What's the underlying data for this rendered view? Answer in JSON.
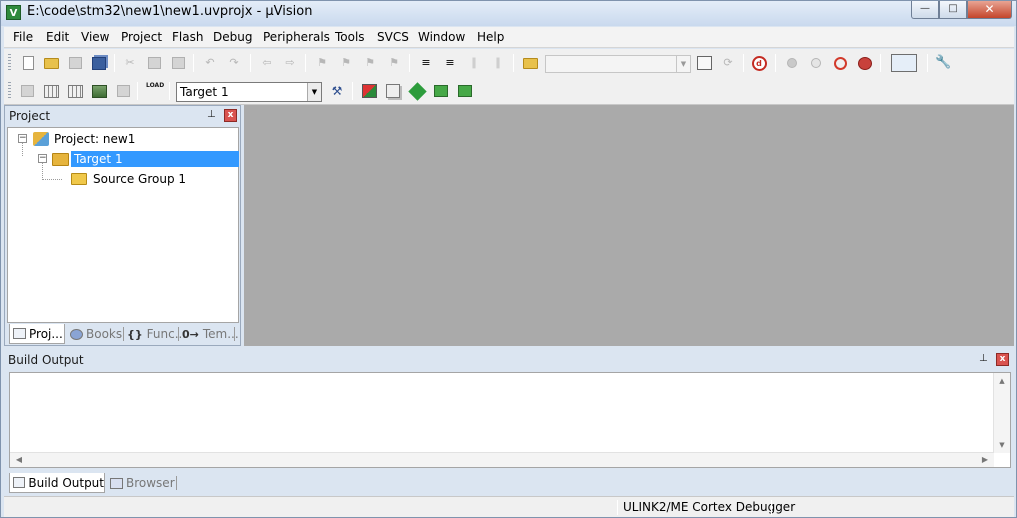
{
  "window": {
    "title": "E:\\code\\stm32\\new1\\new1.uvprojx - µVision",
    "app_icon_letter": "V",
    "controls": {
      "minimize": "—",
      "maximize": "□",
      "close": "✕"
    }
  },
  "menu": [
    "File",
    "Edit",
    "View",
    "Project",
    "Flash",
    "Debug",
    "Peripherals",
    "Tools",
    "SVCS",
    "Window",
    "Help"
  ],
  "toolbar": {
    "find_combo_value": "",
    "target_combo_value": "Target 1",
    "load_label": "LOAD",
    "icons_row1": [
      "new-file-icon",
      "open-folder-icon",
      "save-icon",
      "save-all-icon",
      "cut-icon",
      "copy-icon",
      "paste-icon",
      "undo-icon",
      "redo-icon",
      "nav-back-icon",
      "nav-forward-icon",
      "bookmark-icon",
      "bookmark-prev-icon",
      "bookmark-next-icon",
      "bookmark-clear-icon",
      "indent-icon",
      "unindent-icon",
      "comment-icon",
      "uncomment-icon",
      "find-in-files-icon",
      "find-icon",
      "incremental-find-icon",
      "debug-session-icon",
      "breakpoint-insert-icon",
      "breakpoint-enable-icon",
      "breakpoint-disable-icon",
      "breakpoint-kill-icon",
      "window-view-icon",
      "configure-icon"
    ],
    "icons_row2": [
      "translate-icon",
      "build-icon",
      "rebuild-icon",
      "batch-build-icon",
      "stop-build-icon",
      "download-icon",
      "target-options-icon",
      "manage-components-icon",
      "file-extensions-icon",
      "run-time-environment-icon",
      "pack-installer-icon",
      "select-device-icon"
    ]
  },
  "project_panel": {
    "title": "Project",
    "pin_glyph": "⊥",
    "close_glyph": "x",
    "tree": [
      {
        "label": "Project: new1",
        "icon": "project-icon",
        "expander": "−",
        "selected": false
      },
      {
        "label": "Target 1",
        "icon": "target-folder-icon",
        "expander": "−",
        "selected": true
      },
      {
        "label": "Source Group 1",
        "icon": "folder-icon",
        "expander": "",
        "selected": false
      }
    ],
    "tabs": [
      {
        "label": "Proj...",
        "icon": "project-tab-icon",
        "active": true
      },
      {
        "label": "Books",
        "icon": "books-tab-icon",
        "active": false
      },
      {
        "label": "Func...",
        "icon": "functions-tab-icon",
        "prefix": "{}",
        "active": false
      },
      {
        "label": "Tem...",
        "icon": "templates-tab-icon",
        "prefix": "0→",
        "active": false
      }
    ]
  },
  "build_output": {
    "title": "Build Output",
    "content": "",
    "tabs": [
      {
        "label": "Build Output",
        "icon": "build-output-tab-icon",
        "active": true
      },
      {
        "label": "Browser",
        "icon": "browser-tab-icon",
        "active": false
      }
    ]
  },
  "status_bar": {
    "debugger": "ULINK2/ME Cortex Debugger"
  },
  "colors": {
    "selection": "#3399ff",
    "editor_background": "#aaaaaa",
    "chrome": "#dbe5f1"
  }
}
